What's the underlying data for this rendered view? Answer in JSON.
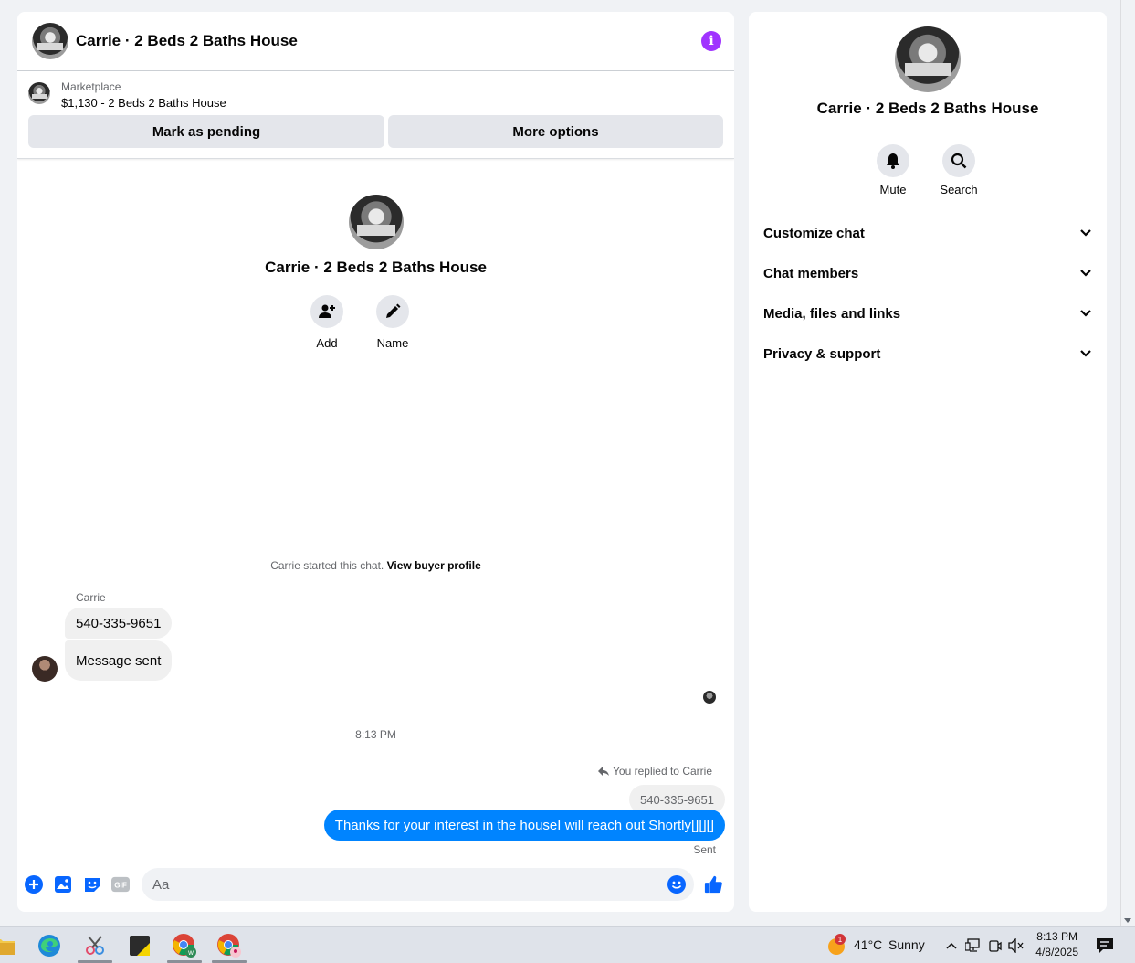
{
  "chat": {
    "title": "Carrie · 2 Beds 2 Baths House",
    "listing": {
      "source": "Marketplace",
      "item": "$1,130 - 2 Beds 2 Baths House",
      "btn_pending": "Mark as pending",
      "btn_more": "More options"
    },
    "intro": {
      "name": "Carrie · 2 Beds 2 Baths House",
      "add_label": "Add",
      "name_label": "Name"
    },
    "started_text": "Carrie started this chat.",
    "view_profile": "View buyer profile",
    "sender_name": "Carrie",
    "messages_in": [
      "540-335-9651",
      "Message sent"
    ],
    "time_separator": "8:13 PM",
    "replied_label": "You replied to Carrie",
    "reply_quote": "540-335-9651",
    "message_out": "Thanks for your interest in the houseI will reach out Shortly[][][]",
    "sent_label": "Sent",
    "composer_placeholder": "Aa"
  },
  "side": {
    "name": "Carrie · 2 Beds 2 Baths House",
    "mute_label": "Mute",
    "search_label": "Search",
    "menu": [
      "Customize chat",
      "Chat members",
      "Media, files and links",
      "Privacy & support"
    ]
  },
  "taskbar": {
    "weather_temp": "41°C",
    "weather_desc": "Sunny",
    "weather_badge": "1",
    "time": "8:13 PM",
    "date": "4/8/2025"
  },
  "colors": {
    "accent": "#0084ff",
    "info": "#a033ff",
    "icon_blue": "#0866ff"
  }
}
